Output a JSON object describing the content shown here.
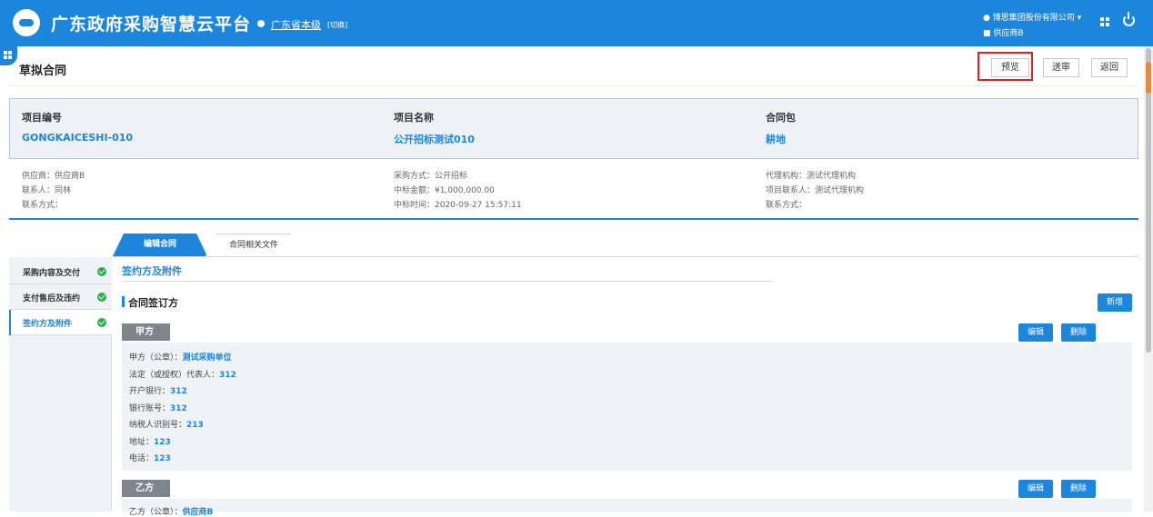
{
  "header": {
    "app_title": "广东政府采购智慧云平台",
    "location": "广东省本级",
    "switch": "[切换]",
    "user_company": "博思集团股份有限公司",
    "user_role": "供应商B",
    "brand_color": "#1c86dc"
  },
  "page": {
    "title": "草拟合同",
    "buttons": {
      "preview": "预览",
      "send": "送审",
      "back": "返回"
    }
  },
  "project": {
    "columns": [
      {
        "label": "项目编号",
        "value": "GONGKAICESHI-010"
      },
      {
        "label": "项目名称",
        "value": "公开招标测试010"
      },
      {
        "label": "合同包",
        "value": "耕地"
      }
    ],
    "meta": [
      [
        "供应商：供应商B",
        "联系人：同林",
        "联系方式："
      ],
      [
        "采购方式：公开招标",
        "中标金额：¥1,000,000.00",
        "中标时间：2020-09-27 15:57:11"
      ],
      [
        "代理机构：测试代理机构",
        "项目联系人：测试代理机构",
        "联系方式："
      ]
    ]
  },
  "tabs": {
    "active": "编辑合同",
    "inactive": "合同相关文件"
  },
  "sidebar": {
    "items": [
      {
        "label": "采购内容及交付",
        "status": "complete"
      },
      {
        "label": "支付售后及违约",
        "status": "complete"
      },
      {
        "label": "签约方及附件",
        "status": "complete"
      }
    ]
  },
  "content": {
    "section_title": "签约方及附件",
    "sub_title": "合同签订方",
    "add_button": "新增",
    "edit_button": "编辑",
    "delete_button": "删除",
    "party_a": {
      "tag": "甲方",
      "fields": [
        {
          "label": "甲方（公章）：",
          "value": "测试采购单位"
        },
        {
          "label": "法定（或授权）代表人：",
          "value": "312"
        },
        {
          "label": "开户银行：",
          "value": "312"
        },
        {
          "label": "银行账号：",
          "value": "312"
        },
        {
          "label": "纳税人识别号：",
          "value": "213"
        },
        {
          "label": "地址：",
          "value": "123"
        },
        {
          "label": "电话：",
          "value": "123"
        }
      ]
    },
    "party_b": {
      "tag": "乙方",
      "fields": [
        {
          "label": "乙方（公章）：",
          "value": "供应商B"
        }
      ]
    }
  }
}
